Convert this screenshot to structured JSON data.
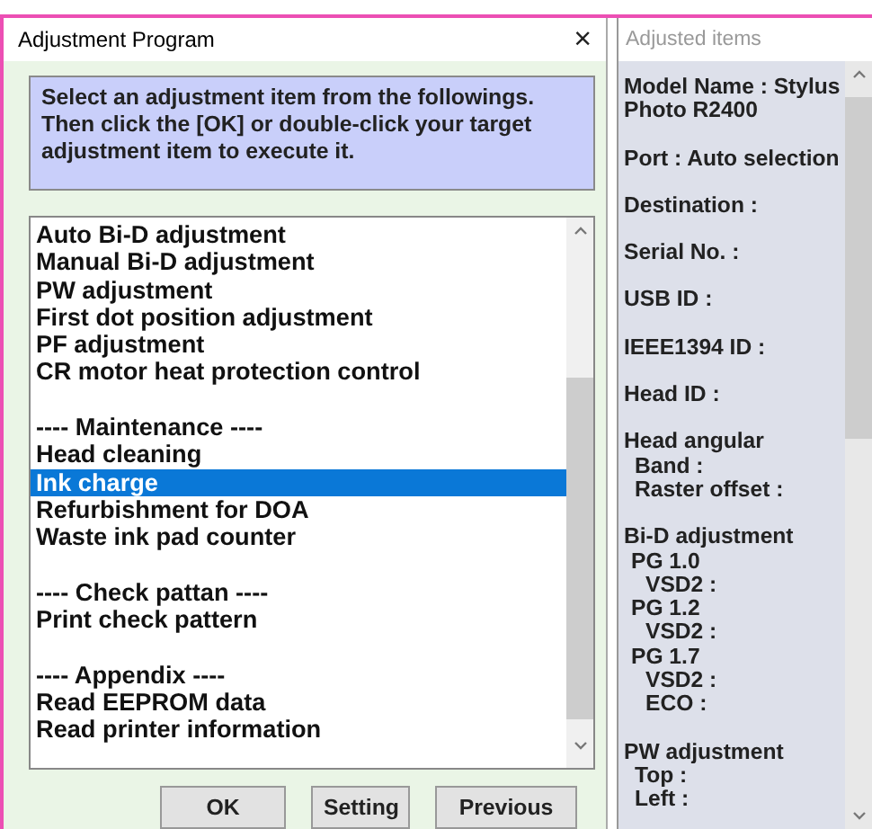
{
  "dialog": {
    "title": "Adjustment Program",
    "close": "×",
    "instruction": "Select an adjustment item from the followings. Then click the [OK] or double-click your target adjustment item to execute it.",
    "items": [
      {
        "kind": "entry",
        "label": "Auto Bi-D adjustment",
        "selected": false
      },
      {
        "kind": "entry",
        "label": "Manual Bi-D adjustment",
        "selected": false
      },
      {
        "kind": "entry",
        "label": "PW adjustment",
        "selected": false
      },
      {
        "kind": "entry",
        "label": "First dot position adjustment",
        "selected": false
      },
      {
        "kind": "entry",
        "label": "PF adjustment",
        "selected": false
      },
      {
        "kind": "entry",
        "label": "CR motor heat protection control",
        "selected": false
      },
      {
        "kind": "spacer"
      },
      {
        "kind": "entry",
        "label": "---- Maintenance ----",
        "selected": false
      },
      {
        "kind": "entry",
        "label": "Head cleaning",
        "selected": false
      },
      {
        "kind": "entry",
        "label": "Ink charge",
        "selected": true
      },
      {
        "kind": "entry",
        "label": "Refurbishment for DOA",
        "selected": false
      },
      {
        "kind": "entry",
        "label": "Waste ink pad counter",
        "selected": false
      },
      {
        "kind": "spacer"
      },
      {
        "kind": "entry",
        "label": "---- Check pattan ----",
        "selected": false
      },
      {
        "kind": "entry",
        "label": "Print check pattern",
        "selected": false
      },
      {
        "kind": "spacer"
      },
      {
        "kind": "entry",
        "label": "---- Appendix ----",
        "selected": false
      },
      {
        "kind": "entry",
        "label": "Read EEPROM data",
        "selected": false
      },
      {
        "kind": "entry",
        "label": "Read printer information",
        "selected": false
      }
    ],
    "buttons": [
      "OK",
      "Setting",
      "Previous"
    ]
  },
  "adjusted_items": {
    "title": "Adjusted items",
    "sections": [
      {
        "label": "Model Name : Stylus Photo R2400"
      },
      {
        "label": "Port : Auto selection"
      },
      {
        "label": "Destination :"
      },
      {
        "label": "Serial No. :"
      },
      {
        "label": "USB ID :"
      },
      {
        "label": "IEEE1394 ID :"
      },
      {
        "label": "Head ID :"
      },
      {
        "label": "Head angular",
        "children": [
          {
            "label": "Band :"
          },
          {
            "label": "Raster offset :"
          }
        ]
      },
      {
        "label": "Bi-D adjustment",
        "children": [
          {
            "label": "PG 1.0",
            "children": [
              {
                "label": "VSD2 :"
              }
            ]
          },
          {
            "label": "PG 1.2",
            "children": [
              {
                "label": "VSD2 :"
              }
            ]
          },
          {
            "label": "PG 1.7",
            "children": [
              {
                "label": "VSD2 :"
              },
              {
                "label": "ECO :"
              }
            ]
          }
        ]
      },
      {
        "label": "PW adjustment",
        "children": [
          {
            "label": "Top :"
          },
          {
            "label": "Left :"
          }
        ]
      }
    ]
  }
}
